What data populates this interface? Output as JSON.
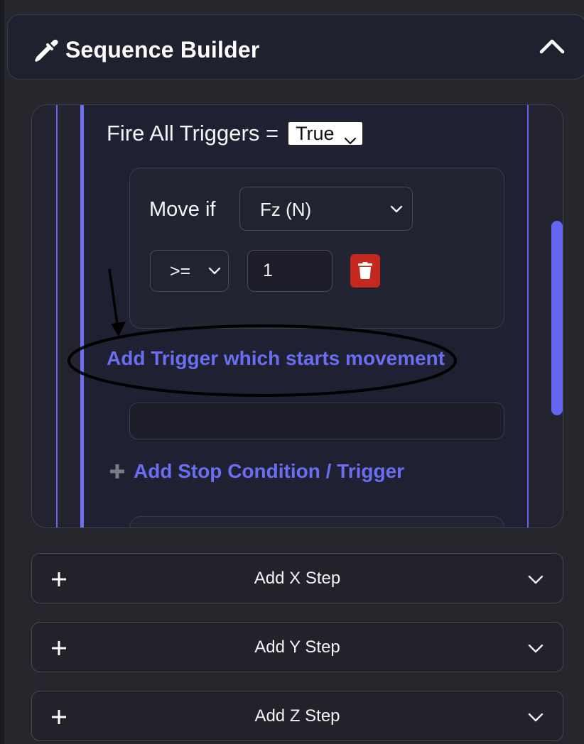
{
  "header": {
    "title": "Sequence Builder",
    "icon": "pipette-icon",
    "collapse_icon": "chevron-up-icon"
  },
  "step": {
    "fire_all_label": "Fire All Triggers =",
    "fire_all_value": "True",
    "trigger": {
      "move_if_label": "Move if",
      "field_value": "Fz (N)",
      "operator_value": ">=",
      "threshold_value": "1",
      "delete_icon": "trash-icon"
    },
    "add_trigger_label": "Add Trigger which starts movement",
    "add_stop_label": "Add Stop Condition / Trigger"
  },
  "steps": [
    {
      "label": "Add X Step"
    },
    {
      "label": "Add Y Step"
    },
    {
      "label": "Add Z Step"
    }
  ],
  "colors": {
    "accent": "#6366f1",
    "link": "#6b6ef2",
    "delete": "#c4281f",
    "background": "#26272d"
  }
}
